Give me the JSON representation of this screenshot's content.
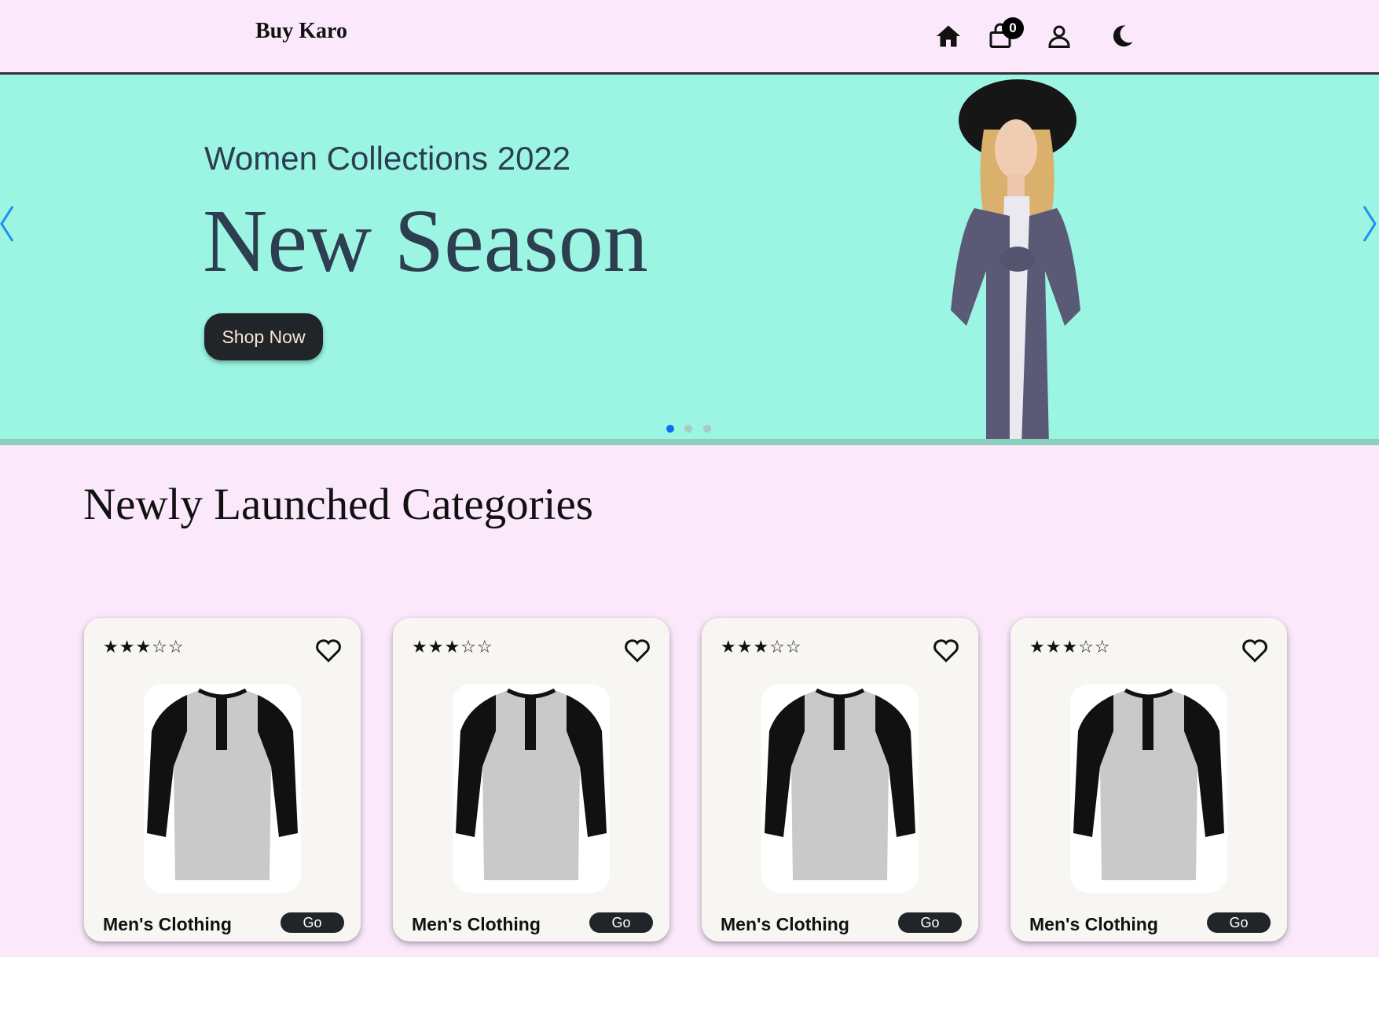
{
  "navbar": {
    "brand": "Buy Karo",
    "cart_count": "0",
    "icons": [
      "home-icon",
      "shopping-bag-icon",
      "user-icon",
      "moon-icon"
    ]
  },
  "hero": {
    "subtitle": "Women Collections 2022",
    "title": "New Season",
    "cta_label": "Shop Now",
    "slide_count": 3,
    "active_slide": 1,
    "background_color": "#9bf5e2"
  },
  "section": {
    "title": "Newly Launched Categories"
  },
  "cards": [
    {
      "rating": 3,
      "stars": "★★★☆☆",
      "label": "Men's Clothing",
      "button": "Go"
    },
    {
      "rating": 3,
      "stars": "★★★☆☆",
      "label": "Men's Clothing",
      "button": "Go"
    },
    {
      "rating": 3,
      "stars": "★★★☆☆",
      "label": "Men's Clothing",
      "button": "Go"
    },
    {
      "rating": 3,
      "stars": "★★★☆☆",
      "label": "Men's Clothing",
      "button": "Go"
    }
  ],
  "colors": {
    "page_background": "#fbe9fb",
    "dark_button": "#212529",
    "accent_dot": "#0d6efd"
  }
}
